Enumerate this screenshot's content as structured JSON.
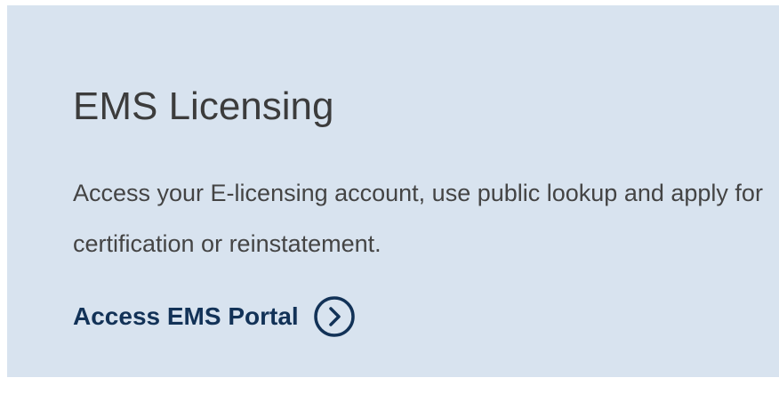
{
  "card": {
    "title": "EMS Licensing",
    "description": "Access your E-licensing account, use public lookup and apply for certification or reinstatement.",
    "link_label": "Access EMS Portal",
    "link_icon": "chevron-right-circle-icon"
  },
  "colors": {
    "card_background": "#d8e3ef",
    "title_text": "#3c3c3c",
    "body_text": "#444444",
    "link": "#123257"
  }
}
